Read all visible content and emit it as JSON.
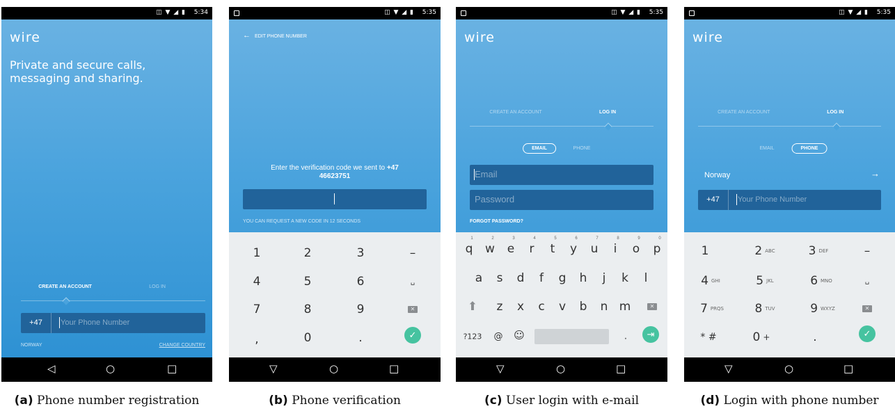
{
  "panels": [
    {
      "status_time": "5:34",
      "brand": "wire",
      "tagline": "Private and secure calls, messaging and sharing.",
      "tabs": {
        "create": "CREATE AN ACCOUNT",
        "login": "LOG IN"
      },
      "country_code": "+47",
      "phone_placeholder": "Your Phone Number",
      "country": "NORWAY",
      "change_country": "CHANGE COUNTRY",
      "caption_letter": "(a)",
      "caption_text": "Phone number registration"
    },
    {
      "status_time": "5:35",
      "back_label": "EDIT PHONE NUMBER",
      "prompt": "Enter the verification code we sent to",
      "prompt_number_a": "+47",
      "prompt_number_b": "46623751",
      "resend_text": "YOU CAN REQUEST A NEW CODE IN 12 SECONDS",
      "keys": [
        "1",
        "2",
        "3",
        "–",
        "4",
        "5",
        "6",
        "␣",
        "7",
        "8",
        "9",
        "⌫",
        ",",
        "0",
        "."
      ],
      "caption_letter": "(b)",
      "caption_text": "Phone verification"
    },
    {
      "status_time": "5:35",
      "brand": "wire",
      "tabs": {
        "create": "CREATE AN ACCOUNT",
        "login": "LOG IN"
      },
      "mode": {
        "email": "EMAIL",
        "phone": "PHONE"
      },
      "email_placeholder": "Email",
      "password_placeholder": "Password",
      "forgot": "FORGOT PASSWORD?",
      "row1": [
        "q",
        "w",
        "e",
        "r",
        "t",
        "y",
        "u",
        "i",
        "o",
        "p"
      ],
      "row1_sup": [
        "1",
        "2",
        "3",
        "4",
        "5",
        "6",
        "7",
        "8",
        "9",
        "0"
      ],
      "row2": [
        "a",
        "s",
        "d",
        "f",
        "g",
        "h",
        "j",
        "k",
        "l"
      ],
      "row3": [
        "z",
        "x",
        "c",
        "v",
        "b",
        "n",
        "m"
      ],
      "symbols_key": "?123",
      "at_key": "@",
      "emoji_key": "☺",
      "period_key": ".",
      "caption_letter": "(c)",
      "caption_text": "User login with e-mail"
    },
    {
      "status_time": "5:35",
      "brand": "wire",
      "tabs": {
        "create": "CREATE AN ACCOUNT",
        "login": "LOG IN"
      },
      "mode": {
        "email": "EMAIL",
        "phone": "PHONE"
      },
      "country": "Norway",
      "country_code": "+47",
      "phone_placeholder": "Your Phone Number",
      "keys": [
        {
          "n": "1",
          "s": ""
        },
        {
          "n": "2",
          "s": "ABC"
        },
        {
          "n": "3",
          "s": "DEF"
        },
        {
          "n": "–",
          "s": ""
        },
        {
          "n": "4",
          "s": "GHI"
        },
        {
          "n": "5",
          "s": "JKL"
        },
        {
          "n": "6",
          "s": "MNO"
        },
        {
          "n": "␣",
          "s": ""
        },
        {
          "n": "7",
          "s": "PRQS"
        },
        {
          "n": "8",
          "s": "TUV"
        },
        {
          "n": "9",
          "s": "WXYZ"
        },
        {
          "n": "⌫",
          "s": ""
        },
        {
          "n": "* #",
          "s": ""
        },
        {
          "n": "0",
          "s": "+"
        },
        {
          "n": ".",
          "s": ""
        }
      ],
      "caption_letter": "(d)",
      "caption_text": "Login with phone number"
    }
  ],
  "status_icons": "◫ ▼ ◢ ▮",
  "nav": {
    "back": "◁",
    "home": "○",
    "recents": "□"
  },
  "colors": {
    "accent": "#46c3a0",
    "blue_top": "#6cb3e3",
    "blue_bottom": "#2a8fd2",
    "field": "#21639a"
  }
}
